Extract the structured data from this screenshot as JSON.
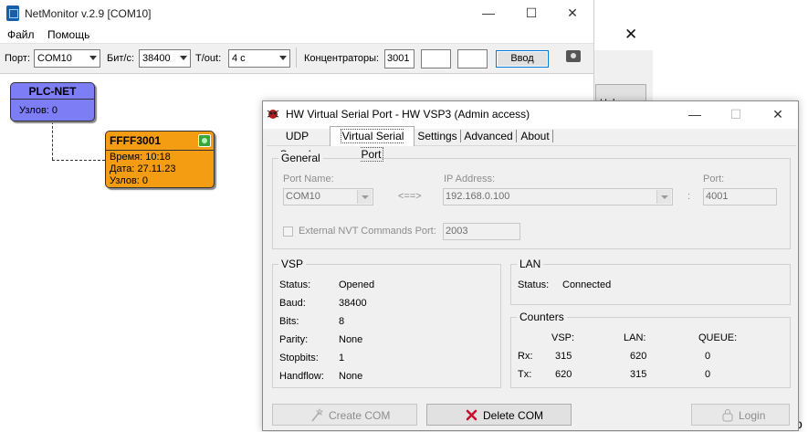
{
  "background_window": {
    "close_glyph": "✕",
    "button_partial": "Help",
    "partial_char": "o"
  },
  "netmonitor": {
    "title": "NetMonitor v.2.9 [COM10]",
    "menu": [
      "Файл",
      "Помощь"
    ],
    "toolbar": {
      "port_label": "Порт:",
      "port_value": "COM10",
      "baud_label": "Бит/с:",
      "baud_value": "38400",
      "timeout_label": "T/out:",
      "timeout_value": "4 с",
      "hubs_label": "Концентраторы:",
      "hub1": "3001",
      "hub2": "",
      "hub3": "",
      "enter_button": "Ввод"
    },
    "nodes": {
      "plc": {
        "title": "PLC-NET",
        "count_line": "Узлов: 0"
      },
      "device": {
        "title": "FFFF3001",
        "time_line": "Время: 10:18",
        "date_line": "Дата: 27.11.23",
        "count_line": "Узлов: 0"
      }
    }
  },
  "vsp_dialog": {
    "title": "HW Virtual Serial Port - HW VSP3 (Admin access)",
    "tabs": [
      "UDP Search",
      "Virtual Serial Port",
      "Settings",
      "Advanced",
      "About"
    ],
    "active_tab": "Virtual Serial Port",
    "general": {
      "title": "General",
      "port_name_label": "Port Name:",
      "port_name_value": "COM10",
      "arrow_text": "<==>",
      "ip_label": "IP Address:",
      "ip_value": "192.168.0.100",
      "colon": ":",
      "port_label": "Port:",
      "port_value": "4001",
      "nvt_label": "External NVT Commands Port:",
      "nvt_value": "2003"
    },
    "vsp": {
      "title": "VSP",
      "rows": [
        {
          "label": "Status:",
          "value": "Opened"
        },
        {
          "label": "Baud:",
          "value": "38400"
        },
        {
          "label": "Bits:",
          "value": "8"
        },
        {
          "label": "Parity:",
          "value": "None"
        },
        {
          "label": "Stopbits:",
          "value": "1"
        },
        {
          "label": "Handflow:",
          "value": "None"
        }
      ]
    },
    "lan": {
      "title": "LAN",
      "status_label": "Status:",
      "status_value": "Connected"
    },
    "counters": {
      "title": "Counters",
      "headers": [
        "VSP:",
        "LAN:",
        "QUEUE:"
      ],
      "rx_label": "Rx:",
      "rx": [
        "315",
        "620",
        "0"
      ],
      "tx_label": "Tx:",
      "tx": [
        "620",
        "315",
        "0"
      ]
    },
    "buttons": {
      "create": "Create COM",
      "delete": "Delete COM",
      "login": "Login"
    }
  }
}
